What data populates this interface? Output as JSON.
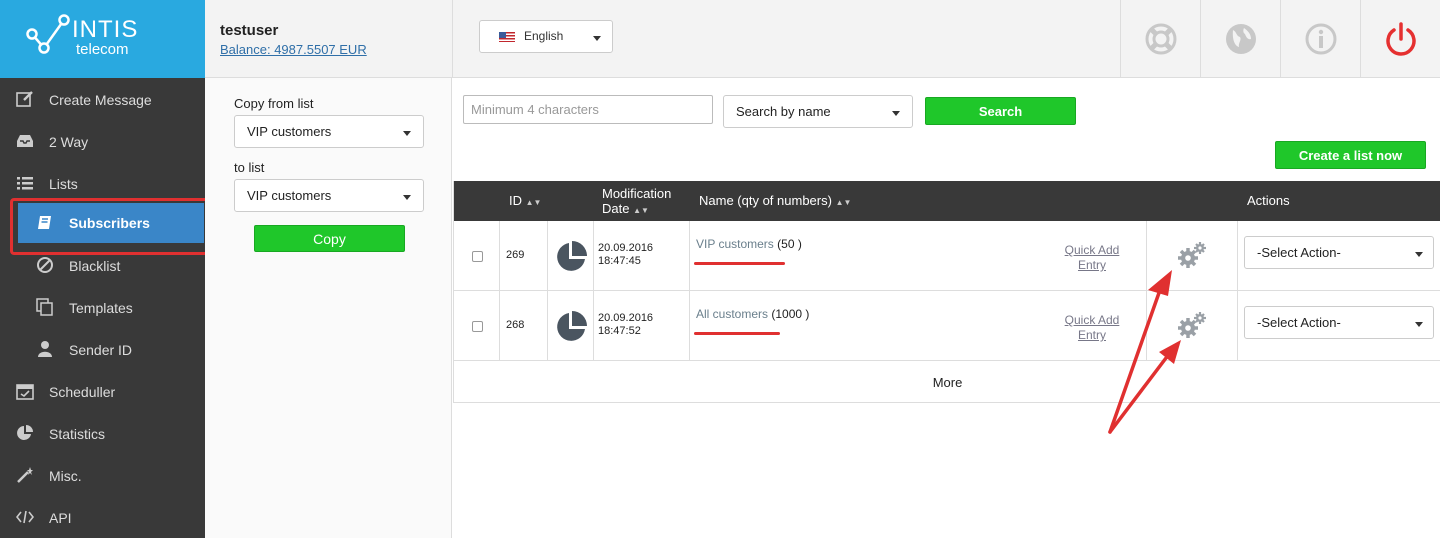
{
  "brand": {
    "line1": "INTIS",
    "line2": "telecom"
  },
  "user": {
    "name": "testuser",
    "balance": "Balance: 4987.5507 EUR"
  },
  "language": {
    "selected": "English"
  },
  "top_icons": [
    "lifebuoy-icon",
    "globe-icon",
    "info-icon",
    "power-icon"
  ],
  "sidebar": {
    "items": [
      {
        "label": "Create Message",
        "icon": "pencil-icon"
      },
      {
        "label": "2 Way",
        "icon": "inbox-icon"
      },
      {
        "label": "Lists",
        "icon": "list-icon"
      },
      {
        "label": "Subscribers",
        "icon": "book-icon"
      },
      {
        "label": "Blacklist",
        "icon": "ban-icon"
      },
      {
        "label": "Templates",
        "icon": "copy-icon"
      },
      {
        "label": "Sender ID",
        "icon": "user-icon"
      },
      {
        "label": "Scheduller",
        "icon": "calendar-icon"
      },
      {
        "label": "Statistics",
        "icon": "pie-icon"
      },
      {
        "label": "Misc.",
        "icon": "wand-icon"
      },
      {
        "label": "API",
        "icon": "code-icon"
      }
    ]
  },
  "copy_panel": {
    "from_label": "Copy from list",
    "from_value": "VIP customers",
    "to_label": "to list",
    "to_value": "VIP customers",
    "button": "Copy"
  },
  "search": {
    "placeholder": "Minimum 4 characters",
    "by": "Search by name",
    "button": "Search"
  },
  "create_button": "Create a list now",
  "table": {
    "headers": {
      "id": "ID",
      "date1": "Modification",
      "date2": "Date",
      "name": "Name (qty of numbers)",
      "actions": "Actions"
    },
    "rows": [
      {
        "id": "269",
        "date": "20.09.2016",
        "time": "18:47:45",
        "name": "VIP customers",
        "qty": "(50 )",
        "quick1": "Quick Add",
        "quick2": "Entry",
        "action": "-Select Action-"
      },
      {
        "id": "268",
        "date": "20.09.2016",
        "time": "18:47:52",
        "name": "All customers",
        "qty": "(1000 )",
        "quick1": "Quick Add",
        "quick2": "Entry",
        "action": "-Select Action-"
      }
    ],
    "more": "More"
  },
  "colors": {
    "accent": "#29a9e0",
    "active": "#3a86c8",
    "green": "#1fc72a",
    "highlight": "#e03030",
    "sidebar": "#393939"
  }
}
